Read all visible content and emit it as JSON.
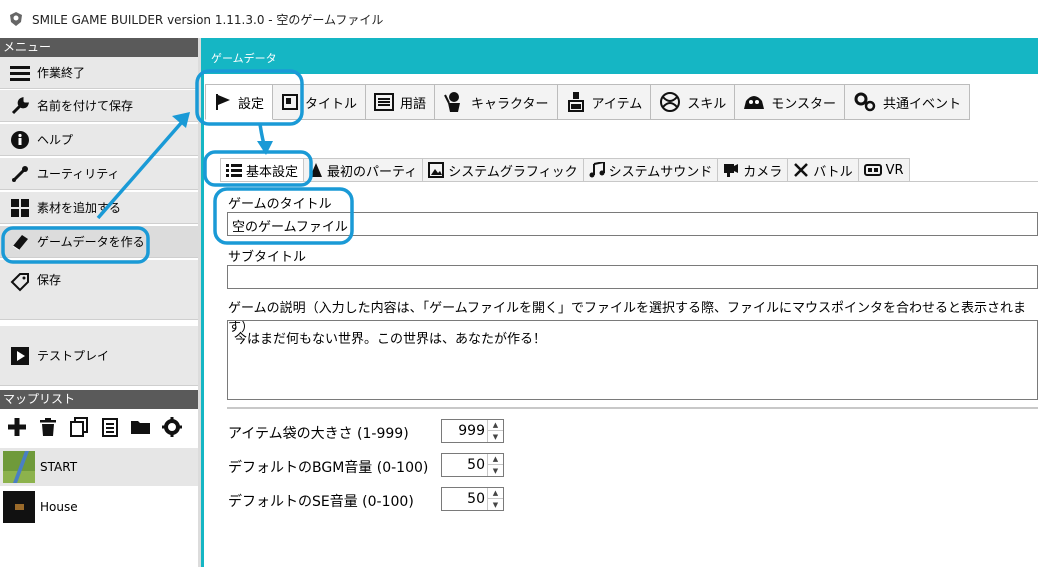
{
  "window": {
    "title": "SMILE GAME BUILDER version 1.11.3.0 - 空のゲームファイル",
    "icon": "app-logo-icon"
  },
  "sidebar": {
    "menu_header": "メニュー",
    "items": [
      {
        "label": "作業終了",
        "icon": "hamburger-icon"
      },
      {
        "label": "名前を付けて保存",
        "icon": "wrench-icon"
      },
      {
        "label": "ヘルプ",
        "icon": "info-icon"
      },
      {
        "label": "ユーティリティ",
        "icon": "tools-icon"
      },
      {
        "label": "素材を追加する",
        "icon": "grid-icon"
      },
      {
        "label": "ゲームデータを作る",
        "icon": "book-icon"
      },
      {
        "label": "保存",
        "icon": "tag-icon"
      },
      {
        "label": "テストプレイ",
        "icon": "play-icon"
      }
    ],
    "maplist_header": "マップリスト",
    "map_toolbar": [
      "plus-icon",
      "trash-icon",
      "copy-icon",
      "clipboard-icon",
      "folder-icon",
      "gear-icon"
    ],
    "maps": [
      {
        "name": "START"
      },
      {
        "name": "House"
      }
    ]
  },
  "main": {
    "header_label": "ゲームデータ",
    "tabs": [
      {
        "label": "設定",
        "icon": "flag-icon"
      },
      {
        "label": "タイトル",
        "icon": "title-icon"
      },
      {
        "label": "用語",
        "icon": "list-icon"
      },
      {
        "label": "キャラクター",
        "icon": "character-icon"
      },
      {
        "label": "アイテム",
        "icon": "potion-icon"
      },
      {
        "label": "スキル",
        "icon": "skill-icon"
      },
      {
        "label": "モンスター",
        "icon": "monster-icon"
      },
      {
        "label": "共通イベント",
        "icon": "gears-icon"
      }
    ],
    "subtabs": [
      {
        "label": "基本設定",
        "icon": "list-icon"
      },
      {
        "label": "最初のパーティ",
        "icon": "party-icon"
      },
      {
        "label": "システムグラフィック",
        "icon": "image-icon"
      },
      {
        "label": "システムサウンド",
        "icon": "music-icon"
      },
      {
        "label": "カメラ",
        "icon": "camera-icon"
      },
      {
        "label": "バトル",
        "icon": "swords-icon"
      },
      {
        "label": "VR",
        "icon": "vr-icon"
      }
    ],
    "fields": {
      "title_label": "ゲームのタイトル",
      "title_value": "空のゲームファイル",
      "subtitle_label": "サブタイトル",
      "subtitle_value": "",
      "description_label": "ゲームの説明（入力した内容は、「ゲームファイルを開く」でファイルを選択する際、ファイルにマウスポインタを合わせると表示されます）",
      "description_value": "今はまだ何もない世界。この世界は、あなたが作る！"
    },
    "numbers": [
      {
        "label": "アイテム袋の大きさ (1-999)",
        "value": "999"
      },
      {
        "label": "デフォルトのBGM音量 (0-100)",
        "value": "50"
      },
      {
        "label": "デフォルトのSE音量 (0-100)",
        "value": "50"
      }
    ]
  },
  "colors": {
    "accent": "#15b6c4",
    "annotation": "#1a9ad6",
    "sidebar_header": "#5a5a5a"
  }
}
